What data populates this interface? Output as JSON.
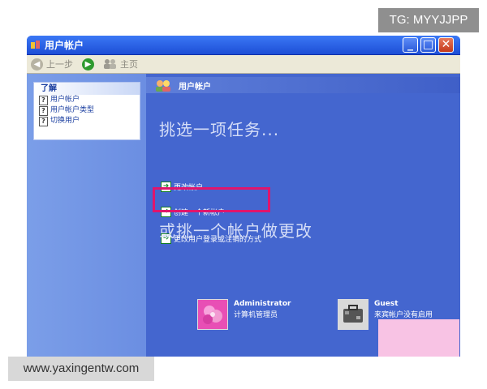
{
  "watermarks": {
    "top_right": "TG: MYYJJPP",
    "bottom_left": "www.yaxingentw.com"
  },
  "window": {
    "title": "用户帐户",
    "controls": {
      "minimize": "_",
      "maximize": "□",
      "close": "✕"
    }
  },
  "toolbar": {
    "back_label": "上一步",
    "home_label": "主页"
  },
  "sidebar": {
    "learn_title": "了解",
    "items": [
      {
        "label": "用户帐户"
      },
      {
        "label": "用户帐户类型"
      },
      {
        "label": "切换用户"
      }
    ]
  },
  "main": {
    "header_title": "用户帐户",
    "task_heading": "挑选一项任务...",
    "tasks": [
      {
        "label": "更改帐户"
      },
      {
        "label": "创建一个新帐户"
      },
      {
        "label": "更改用户登录或注销的方式"
      }
    ],
    "accounts_heading": "或挑一个帐户做更改",
    "accounts": [
      {
        "name": "Administrator",
        "description": "计算机管理员"
      },
      {
        "name": "Guest",
        "description": "来宾帐户没有启用"
      }
    ]
  },
  "colors": {
    "highlight": "#e0156c",
    "window_blue": "#2652d8",
    "pink_overlay": "#f8c3e4"
  }
}
